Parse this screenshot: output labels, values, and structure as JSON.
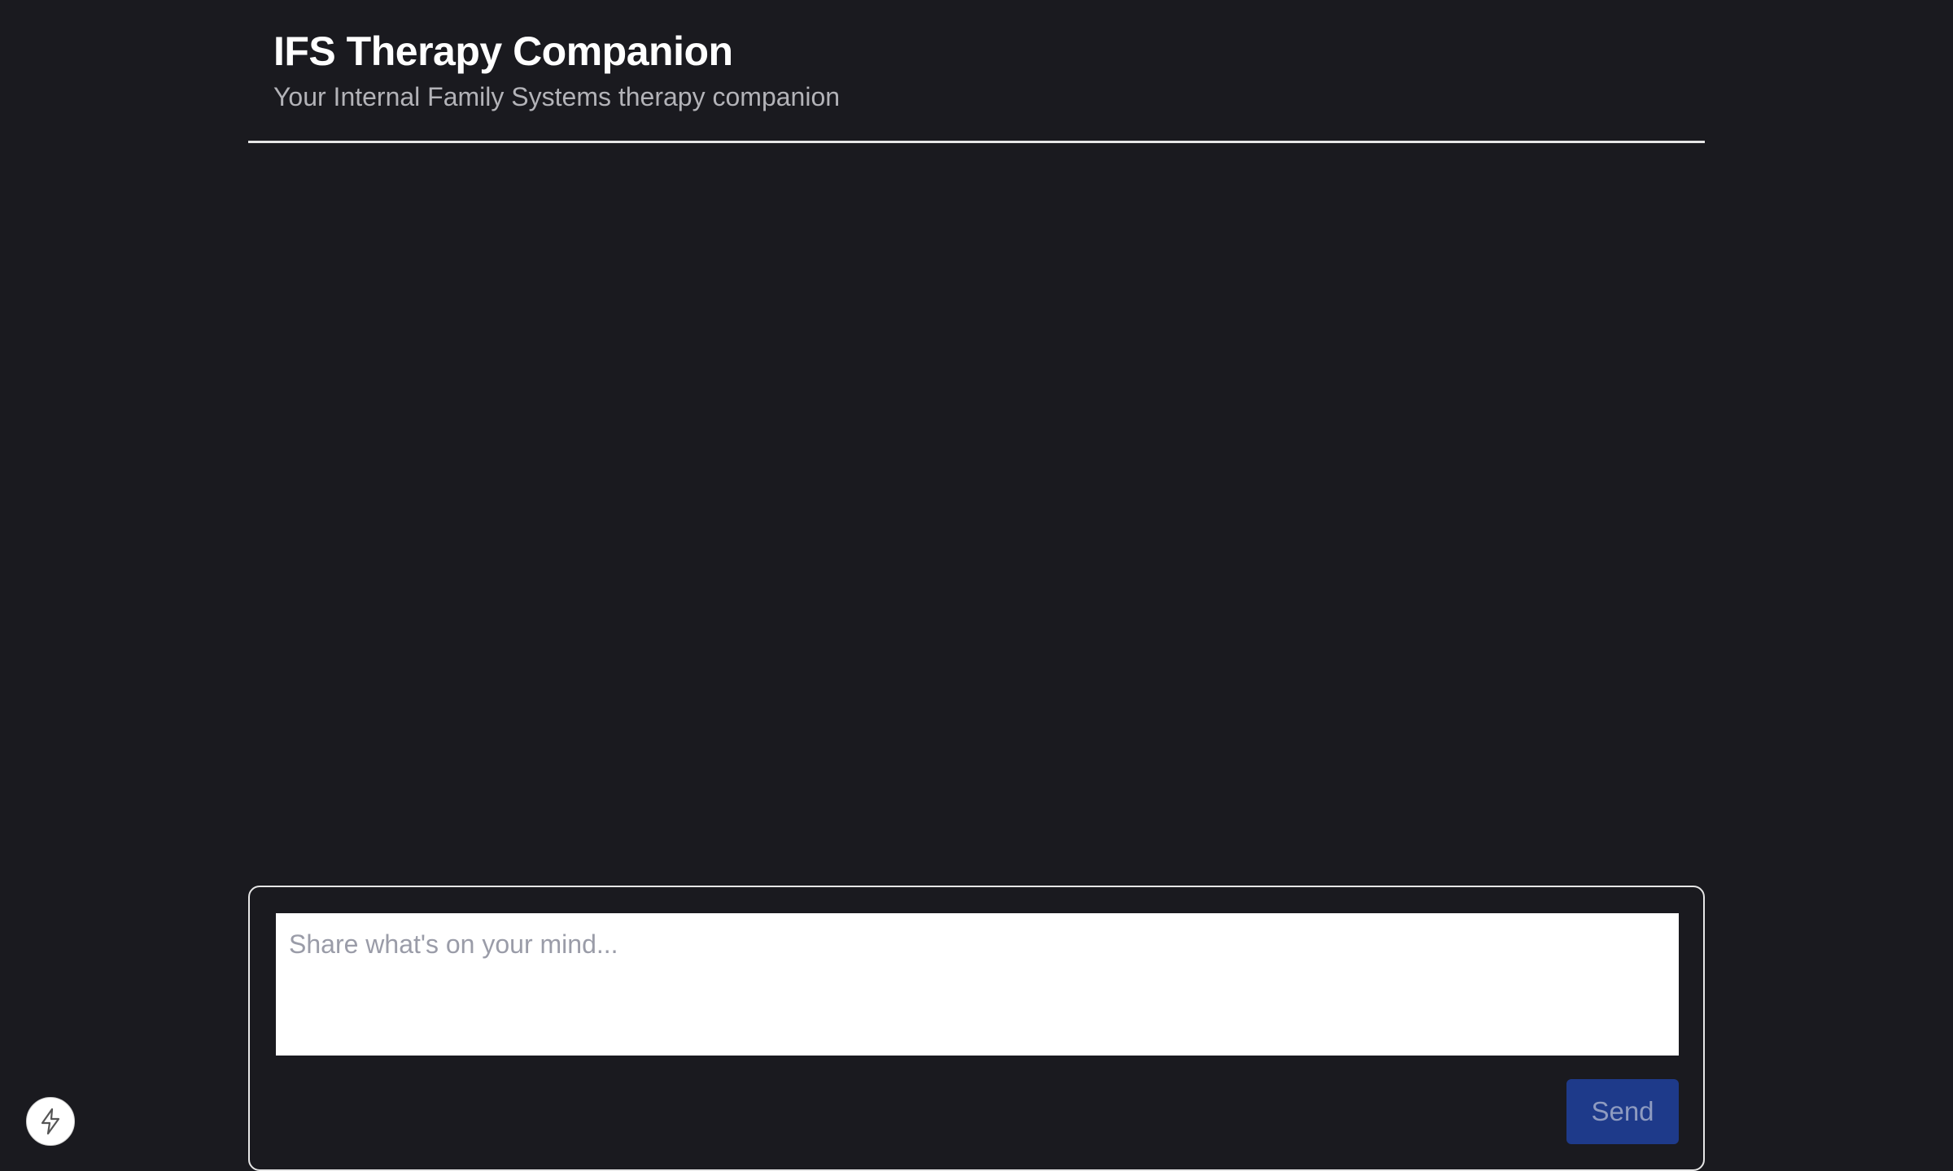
{
  "header": {
    "title": "IFS Therapy Companion",
    "subtitle": "Your Internal Family Systems therapy companion"
  },
  "composer": {
    "input_value": "",
    "input_placeholder": "Share what's on your mind...",
    "send_label": "Send"
  },
  "floating_button": {
    "icon": "lightning-bolt-icon"
  },
  "colors": {
    "background": "#1a1a1f",
    "send_button": "#1e3a8a",
    "divider": "#e6e6e6"
  }
}
